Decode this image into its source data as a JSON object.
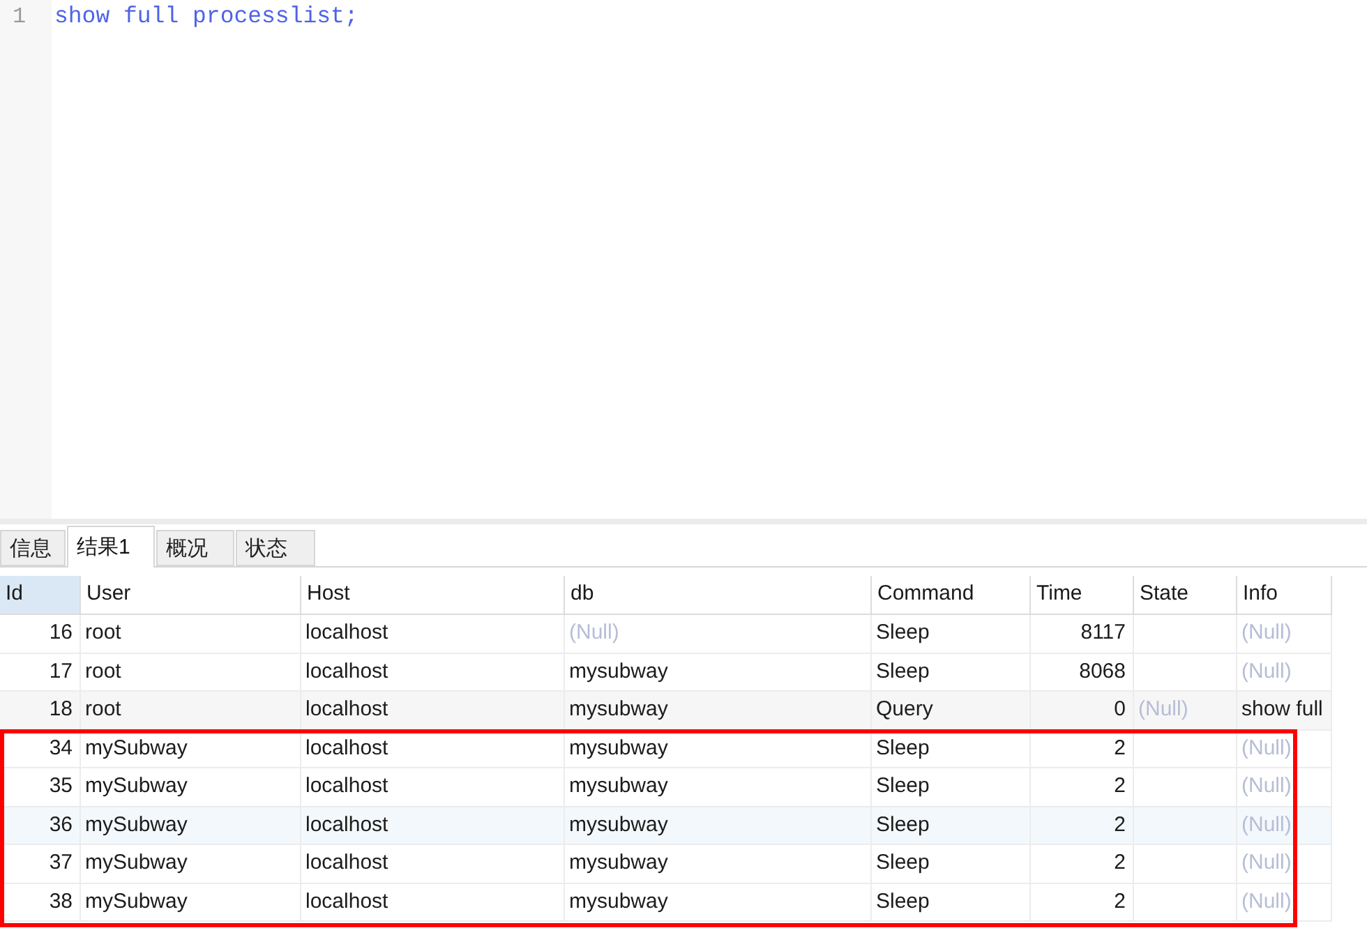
{
  "editor": {
    "lines": [
      {
        "number": "1",
        "code": "show full processlist;"
      }
    ]
  },
  "result_tabs": [
    {
      "label": "信息",
      "selected": false
    },
    {
      "label": "结果1",
      "selected": true
    },
    {
      "label": "概况",
      "selected": false
    },
    {
      "label": "状态",
      "selected": false
    }
  ],
  "table": {
    "columns": [
      {
        "label": "Id",
        "kind": "number",
        "selected": true
      },
      {
        "label": "User",
        "kind": "text",
        "selected": false
      },
      {
        "label": "Host",
        "kind": "text",
        "selected": false
      },
      {
        "label": "db",
        "kind": "text",
        "selected": false
      },
      {
        "label": "Command",
        "kind": "text",
        "selected": false
      },
      {
        "label": "Time",
        "kind": "number",
        "selected": false
      },
      {
        "label": "State",
        "kind": "text",
        "selected": false
      },
      {
        "label": "Info",
        "kind": "text",
        "selected": false
      }
    ],
    "rows": [
      {
        "color": "#ffffff",
        "marked": false,
        "cells": [
          "16",
          "root",
          "localhost",
          {
            "text": "(Null)",
            "kind": "null"
          },
          "Sleep",
          "8117",
          null,
          {
            "text": "(Null)",
            "kind": "null"
          }
        ]
      },
      {
        "color": "#ffffff",
        "marked": false,
        "cells": [
          "17",
          "root",
          "localhost",
          "mysubway",
          "Sleep",
          "8068",
          null,
          {
            "text": "(Null)",
            "kind": "null"
          }
        ]
      },
      {
        "color": "#f6f6f6",
        "marked": false,
        "cells": [
          "18",
          "root",
          "localhost",
          "mysubway",
          "Query",
          "0",
          {
            "text": "(Null)",
            "kind": "null"
          },
          "show full"
        ]
      },
      {
        "color": "#ffffff",
        "marked": true,
        "cells": [
          "34",
          "mySubway",
          "localhost",
          "mysubway",
          "Sleep",
          "2",
          null,
          {
            "text": "(Null)",
            "kind": "null"
          }
        ]
      },
      {
        "color": "#ffffff",
        "marked": true,
        "cells": [
          "35",
          "mySubway",
          "localhost",
          "mysubway",
          "Sleep",
          "2",
          null,
          {
            "text": "(Null)",
            "kind": "null"
          }
        ]
      },
      {
        "color": "#f3f8fc",
        "marked": true,
        "cells": [
          "36",
          "mySubway",
          "localhost",
          "mysubway",
          "Sleep",
          "2",
          null,
          {
            "text": "(Null)",
            "kind": "null"
          }
        ]
      },
      {
        "color": "#ffffff",
        "marked": true,
        "cells": [
          "37",
          "mySubway",
          "localhost",
          "mysubway",
          "Sleep",
          "2",
          null,
          {
            "text": "(Null)",
            "kind": "null"
          }
        ]
      },
      {
        "color": "#ffffff",
        "marked": true,
        "cells": [
          "38",
          "mySubway",
          "localhost",
          "mysubway",
          "Sleep",
          "2",
          null,
          {
            "text": "(Null)",
            "kind": "null"
          }
        ]
      }
    ]
  }
}
